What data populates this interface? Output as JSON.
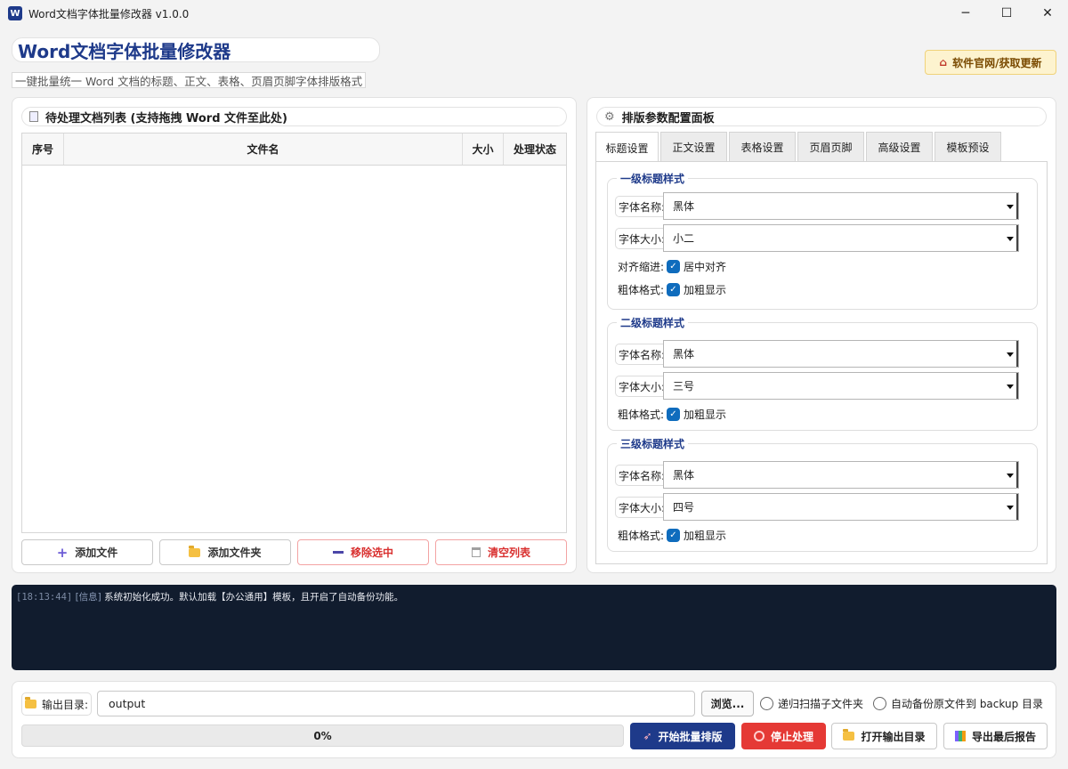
{
  "window": {
    "title": "Word文档字体批量修改器 v1.0.0",
    "icon_letter": "W",
    "minimize": "─",
    "maximize": "☐",
    "close": "✕"
  },
  "header": {
    "title": "Word文档字体批量修改器",
    "subtitle": "一键批量统一 Word 文档的标题、正文、表格、页眉页脚字体排版格式",
    "update_button": "软件官网/获取更新"
  },
  "file_panel": {
    "title": "待处理文档列表 (支持拖拽 Word 文件至此处)",
    "columns": [
      "序号",
      "文件名",
      "大小",
      "处理状态"
    ],
    "rows": [],
    "buttons": {
      "add_file": "添加文件",
      "add_folder": "添加文件夹",
      "remove_selected": "移除选中",
      "clear_list": "清空列表"
    }
  },
  "config_panel": {
    "title": "排版参数配置面板",
    "tabs": [
      "标题设置",
      "正文设置",
      "表格设置",
      "页眉页脚",
      "高级设置",
      "模板预设"
    ],
    "active_tab": "标题设置",
    "groups": [
      {
        "title": "一级标题样式",
        "font_name_label": "字体名称:",
        "font_name": "黑体",
        "font_size_label": "字体大小:",
        "font_size": "小二",
        "align_label": "对齐缩进:",
        "align_check": "居中对齐",
        "bold_label": "粗体格式:",
        "bold_check": "加粗显示"
      },
      {
        "title": "二级标题样式",
        "font_name_label": "字体名称:",
        "font_name": "黑体",
        "font_size_label": "字体大小:",
        "font_size": "三号",
        "bold_label": "粗体格式:",
        "bold_check": "加粗显示"
      },
      {
        "title": "三级标题样式",
        "font_name_label": "字体名称:",
        "font_name": "黑体",
        "font_size_label": "字体大小:",
        "font_size": "四号",
        "bold_label": "粗体格式:",
        "bold_check": "加粗显示"
      }
    ]
  },
  "log": {
    "time": "[18:13:44]",
    "level": "[信息]",
    "message": "系统初始化成功。默认加载【办公通用】模板，且开启了自动备份功能。"
  },
  "bottom": {
    "output_label": "输出目录:",
    "output_value": "output",
    "browse": "浏览...",
    "recursive": "递归扫描子文件夹",
    "backup": "自动备份原文件到 backup 目录",
    "progress_text": "0%",
    "progress_value": 0,
    "start": "开始批量排版",
    "stop": "停止处理",
    "open_output": "打开输出目录",
    "export_report": "导出最后报告"
  }
}
